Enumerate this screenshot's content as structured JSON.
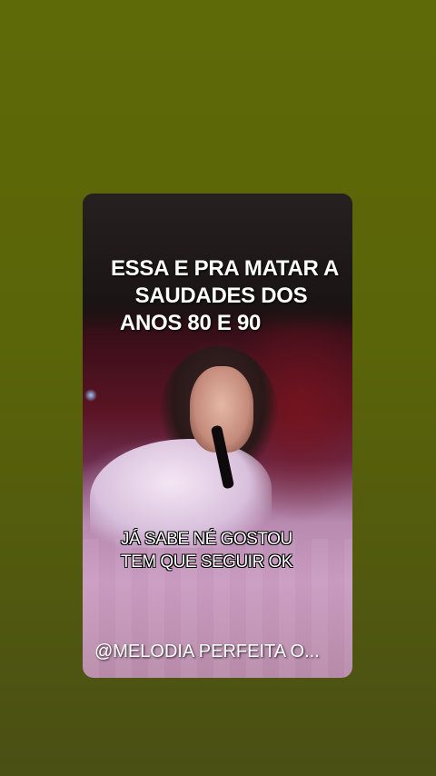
{
  "story": {
    "title_lines": [
      "ESSA E PRA MATAR A",
      "SAUDADES DOS",
      "ANOS 80 E 90"
    ],
    "caption_lines": [
      "JÁ SABE NÉ GOSTOU",
      "TEM QUE SEGUIR OK"
    ],
    "handle": "@MELODIA PERFEITA O..."
  },
  "colors": {
    "background": "#5e6a08",
    "text": "#ffffff"
  }
}
